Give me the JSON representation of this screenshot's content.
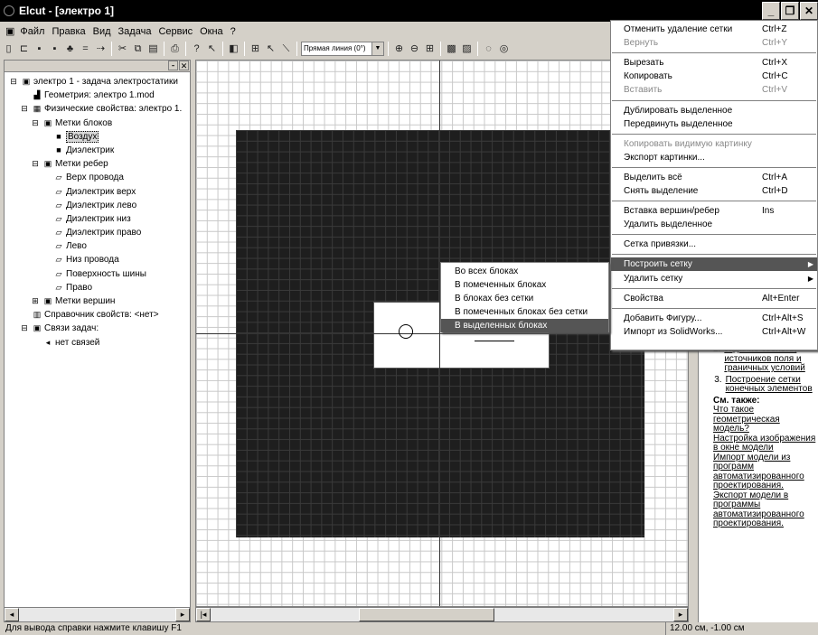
{
  "window": {
    "title": "Elcut - [электро 1]",
    "buttons": [
      "_",
      "❐",
      "✕"
    ]
  },
  "menu": [
    "Файл",
    "Правка",
    "Вид",
    "Задача",
    "Сервис",
    "Окна",
    "?"
  ],
  "toolbar": {
    "combo": "Прямая линия (0°)"
  },
  "tree": [
    {
      "text": "электро 1 - задача электростатики",
      "indent": 0,
      "icon": "⊟",
      "ico2": "▣"
    },
    {
      "text": "Геометрия: электро 1.mod",
      "indent": 1,
      "icon": "",
      "ico2": "▟"
    },
    {
      "text": "Физические свойства: электро 1.",
      "indent": 1,
      "icon": "⊟",
      "ico2": "▦"
    },
    {
      "text": "Метки блоков",
      "indent": 2,
      "icon": "⊟",
      "ico2": "▣"
    },
    {
      "text": "Воздух",
      "indent": 3,
      "icon": "",
      "ico2": "■",
      "sel": true
    },
    {
      "text": "Диэлектрик",
      "indent": 3,
      "icon": "",
      "ico2": "■"
    },
    {
      "text": "Метки ребер",
      "indent": 2,
      "icon": "⊟",
      "ico2": "▣"
    },
    {
      "text": "Верх провода",
      "indent": 3,
      "icon": "",
      "ico2": "▱"
    },
    {
      "text": "Диэлектрик верх",
      "indent": 3,
      "icon": "",
      "ico2": "▱"
    },
    {
      "text": "Диэлектрик лево",
      "indent": 3,
      "icon": "",
      "ico2": "▱"
    },
    {
      "text": "Диэлектрик низ",
      "indent": 3,
      "icon": "",
      "ico2": "▱"
    },
    {
      "text": "Диэлектрик право",
      "indent": 3,
      "icon": "",
      "ico2": "▱"
    },
    {
      "text": "Лево",
      "indent": 3,
      "icon": "",
      "ico2": "▱"
    },
    {
      "text": "Низ провода",
      "indent": 3,
      "icon": "",
      "ico2": "▱"
    },
    {
      "text": "Поверхность шины",
      "indent": 3,
      "icon": "",
      "ico2": "▱"
    },
    {
      "text": "Право",
      "indent": 3,
      "icon": "",
      "ico2": "▱"
    },
    {
      "text": "Метки вершин",
      "indent": 2,
      "icon": "⊞",
      "ico2": "▣"
    },
    {
      "text": "Справочник свойств: <нет>",
      "indent": 1,
      "icon": "",
      "ico2": "▥"
    },
    {
      "text": "Связи задач:",
      "indent": 1,
      "icon": "⊟",
      "ico2": "▣"
    },
    {
      "text": "нет связей",
      "indent": 2,
      "icon": "",
      "ico2": "◂"
    }
  ],
  "context_menu": [
    {
      "label": "Отменить удаление сетки",
      "shortcut": "Ctrl+Z"
    },
    {
      "label": "Вернуть",
      "shortcut": "Ctrl+Y",
      "disabled": true
    },
    {
      "sep": true
    },
    {
      "label": "Вырезать",
      "shortcut": "Ctrl+X"
    },
    {
      "label": "Копировать",
      "shortcut": "Ctrl+C"
    },
    {
      "label": "Вставить",
      "shortcut": "Ctrl+V",
      "disabled": true
    },
    {
      "sep": true
    },
    {
      "label": "Дублировать выделенное",
      "shortcut": ""
    },
    {
      "label": "Передвинуть выделенное",
      "shortcut": ""
    },
    {
      "sep": true
    },
    {
      "label": "Копировать видимую картинку",
      "shortcut": "",
      "disabled": true
    },
    {
      "label": "Экспорт картинки...",
      "shortcut": ""
    },
    {
      "sep": true
    },
    {
      "label": "Выделить всё",
      "shortcut": "Ctrl+A"
    },
    {
      "label": "Снять выделение",
      "shortcut": "Ctrl+D"
    },
    {
      "sep": true
    },
    {
      "label": "Вставка вершин/ребер",
      "shortcut": "Ins"
    },
    {
      "label": "Удалить выделенное",
      "shortcut": ""
    },
    {
      "sep": true
    },
    {
      "label": "Сетка привязки...",
      "shortcut": ""
    },
    {
      "sep": true
    },
    {
      "label": "Построить сетку",
      "shortcut": "",
      "highlighted": true,
      "submenu": true
    },
    {
      "label": "Удалить сетку",
      "shortcut": "",
      "submenu": true
    },
    {
      "sep": true
    },
    {
      "label": "Свойства",
      "shortcut": "Alt+Enter"
    },
    {
      "sep": true
    },
    {
      "label": "Добавить Фигуру...",
      "shortcut": "Ctrl+Alt+S"
    },
    {
      "label": "Импорт из SolidWorks...",
      "shortcut": "Ctrl+Alt+W"
    }
  ],
  "submenu": [
    {
      "label": "Во всех блоках"
    },
    {
      "label": "В помеченных блоках"
    },
    {
      "label": "В блоках без сетки"
    },
    {
      "label": "В помеченных блоках без сетки"
    },
    {
      "label": "В выделенных блоках",
      "highlighted": true
    }
  ],
  "help": {
    "item2_label": "2.",
    "item2": "задание свойств, источников поля и граничных условий",
    "item3_label": "3.",
    "item3": "Построение сетки конечных элементов",
    "see_also": "См. также:",
    "links": [
      "Что такое геометрическая модель?",
      "Настройка изображения в окне модели",
      "Импорт модели из программ автоматизированного проектирования.",
      "Экспорт модели в программы автоматизированного проектирования."
    ]
  },
  "status": {
    "hint": "Для вывода справки нажмите клавишу F1",
    "coords": "12.00 см, -1.00 см"
  }
}
